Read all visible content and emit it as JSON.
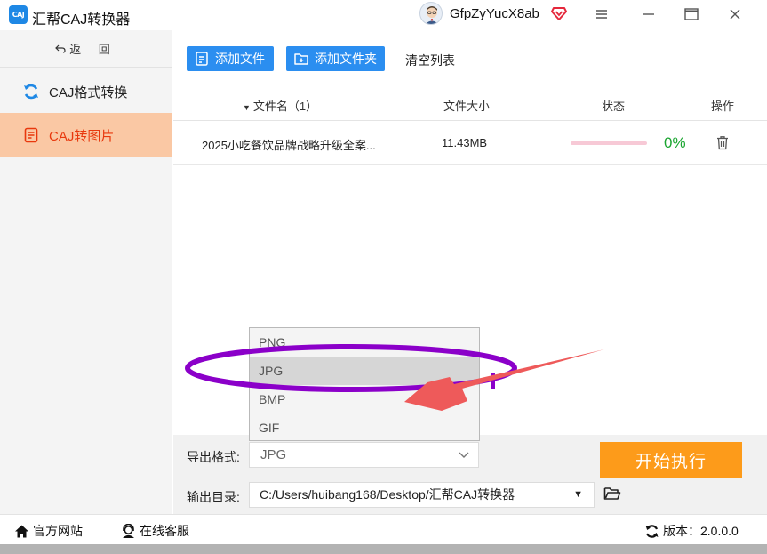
{
  "app": {
    "logo_text": "CAJ",
    "title": "汇帮CAJ转换器",
    "username": "GfpZyYucX8ab"
  },
  "sidebar": {
    "back_label": "返 回",
    "items": [
      {
        "label": "CAJ格式转换",
        "icon": "refresh-icon"
      },
      {
        "label": "CAJ转图片",
        "icon": "document-icon",
        "active": true
      }
    ]
  },
  "toolbar": {
    "add_file": "添加文件",
    "add_folder": "添加文件夹",
    "clear_list": "清空列表"
  },
  "table": {
    "columns": {
      "name": "文件名（1）",
      "size": "文件大小",
      "status": "状态",
      "actions": "操作"
    },
    "rows": [
      {
        "name": "2025小吃餐饮品牌战略升级全案...",
        "size": "11.43MB",
        "progress": 0,
        "percent": "0%"
      }
    ]
  },
  "output": {
    "format_label": "导出格式:",
    "format_value": "JPG",
    "format_options": [
      "PNG",
      "JPG",
      "BMP",
      "GIF"
    ],
    "dir_label": "输出目录:",
    "dir_value": "C:/Users/huibang168/Desktop/汇帮CAJ转换器",
    "start_button": "开始执行"
  },
  "footer": {
    "website": "官方网站",
    "service": "在线客服",
    "version": "版本：2.0.0.0"
  },
  "colors": {
    "accent_blue": "#2b8ef0",
    "active_bg": "#fac8a4",
    "active_text": "#e8380d",
    "start_orange": "#fd9b1a",
    "percent_green": "#1aa530",
    "annotation_purple": "#8b00c9",
    "annotation_arrow": "#ee5a5a"
  }
}
